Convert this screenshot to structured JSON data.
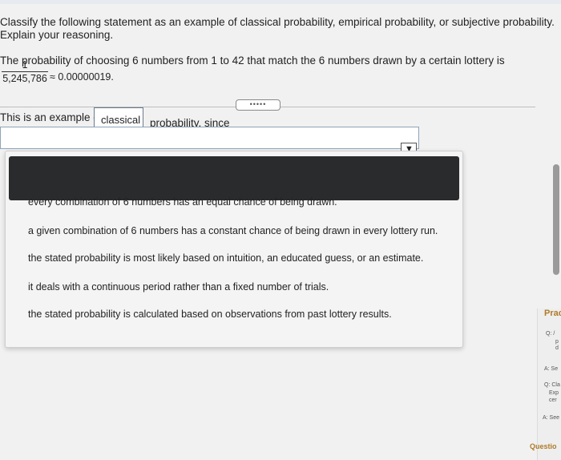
{
  "question": {
    "line1": "Classify the following statement as an example of classical probability, empirical probability, or subjective probability.",
    "line2": "Explain your reasoning.",
    "statement": "The probability of choosing 6 numbers from 1 to 42 that match the 6 numbers drawn by a certain lottery is",
    "frac_num": "1",
    "frac_den": "5,245,786",
    "approx": "≈ 0.00000019."
  },
  "more_button": "•••••",
  "answer": {
    "prefix": "This is an example of",
    "selected": "classical",
    "suffix": "probability, since"
  },
  "dropdown_arrow": "▼",
  "options": [
    "every combination of 6 numbers has an equal chance of being drawn.",
    "a given combination of 6 numbers has a constant chance of being drawn in every lottery run.",
    "the stated probability is most likely based on intuition, an educated guess, or an estimate.",
    "it deals with a continuous period rather than a fixed number of trials.",
    "the stated probability is calculated based on observations from past lottery results."
  ],
  "side_panel": {
    "title": "Prac",
    "q1": "Q: /",
    "q1b": "p",
    "q1c": "d",
    "a1": "A: Se",
    "q2": "Q: Cla",
    "q2b": "Exp",
    "q2c": "cer",
    "a2": "A: See",
    "footer": "Questio"
  }
}
